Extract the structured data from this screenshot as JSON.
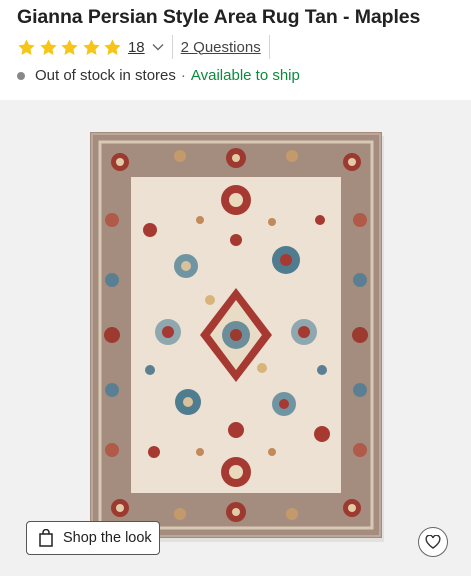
{
  "product": {
    "title": "Gianna Persian Style Area Rug Tan - Maples",
    "rating": 5,
    "review_count": "18",
    "questions_label": "2 Questions"
  },
  "availability": {
    "in_store": "Out of stock in stores",
    "separator": "·",
    "ship": "Available to ship"
  },
  "actions": {
    "shop_the_look": "Shop the look"
  },
  "colors": {
    "star": "#f5c518",
    "available": "#0c8a3a",
    "gallery_bg": "#f1f1f1"
  },
  "icons": [
    "star-icon",
    "chevron-down-icon",
    "shopping-bag-icon",
    "heart-icon"
  ]
}
